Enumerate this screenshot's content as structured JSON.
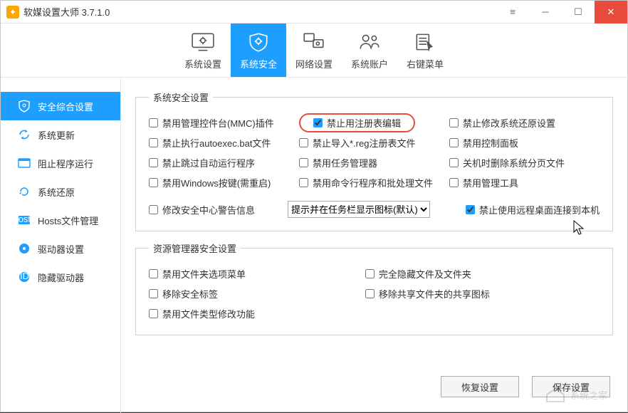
{
  "window": {
    "title": "软媒设置大师 3.7.1.0"
  },
  "tabs": [
    {
      "id": "system-settings",
      "label": "系统设置"
    },
    {
      "id": "system-security",
      "label": "系统安全"
    },
    {
      "id": "network-settings",
      "label": "网络设置"
    },
    {
      "id": "system-account",
      "label": "系统账户"
    },
    {
      "id": "context-menu",
      "label": "右键菜单"
    }
  ],
  "sidebar": {
    "items": [
      {
        "id": "security-overview",
        "label": "安全综合设置"
      },
      {
        "id": "system-update",
        "label": "系统更新"
      },
      {
        "id": "block-run",
        "label": "阻止程序运行"
      },
      {
        "id": "system-restore",
        "label": "系统还原"
      },
      {
        "id": "hosts",
        "label": "Hosts文件管理"
      },
      {
        "id": "drive-settings",
        "label": "驱动器设置"
      },
      {
        "id": "hide-drives",
        "label": "隐藏驱动器"
      }
    ]
  },
  "groups": {
    "g1": {
      "legend": "系统安全设置",
      "items": {
        "mmc": "禁用管理控件台(MMC)插件",
        "regedit": "禁止用注册表编辑",
        "restore_mod": "禁止修改系统还原设置",
        "autoexec": "禁止执行autoexec.bat文件",
        "import_reg": "禁止导入*.reg注册表文件",
        "ctrlpanel": "禁用控制面板",
        "autorun": "禁止跳过自动运行程序",
        "taskmgr": "禁用任务管理器",
        "del_pagefile": "关机时删除系统分页文件",
        "winkey": "禁用Windows按键(需重启)",
        "cmd_batch": "禁用命令行程序和批处理文件",
        "admintools": "禁用管理工具",
        "sec_center": "修改安全中心警告信息",
        "remote_desktop": "禁止使用远程桌面连接到本机"
      },
      "select": {
        "selected": "提示并在任务栏显示图标(默认)"
      }
    },
    "g2": {
      "legend": "资源管理器安全设置",
      "items": {
        "folder_opts": "禁用文件夹选项菜单",
        "hide_files": "完全隐藏文件及文件夹",
        "sec_tab": "移除安全标签",
        "share_icon": "移除共享文件夹的共享图标",
        "filetype": "禁用文件类型修改功能"
      }
    }
  },
  "footer": {
    "restore": "恢复设置",
    "save": "保存设置"
  },
  "watermark": "系统之家"
}
